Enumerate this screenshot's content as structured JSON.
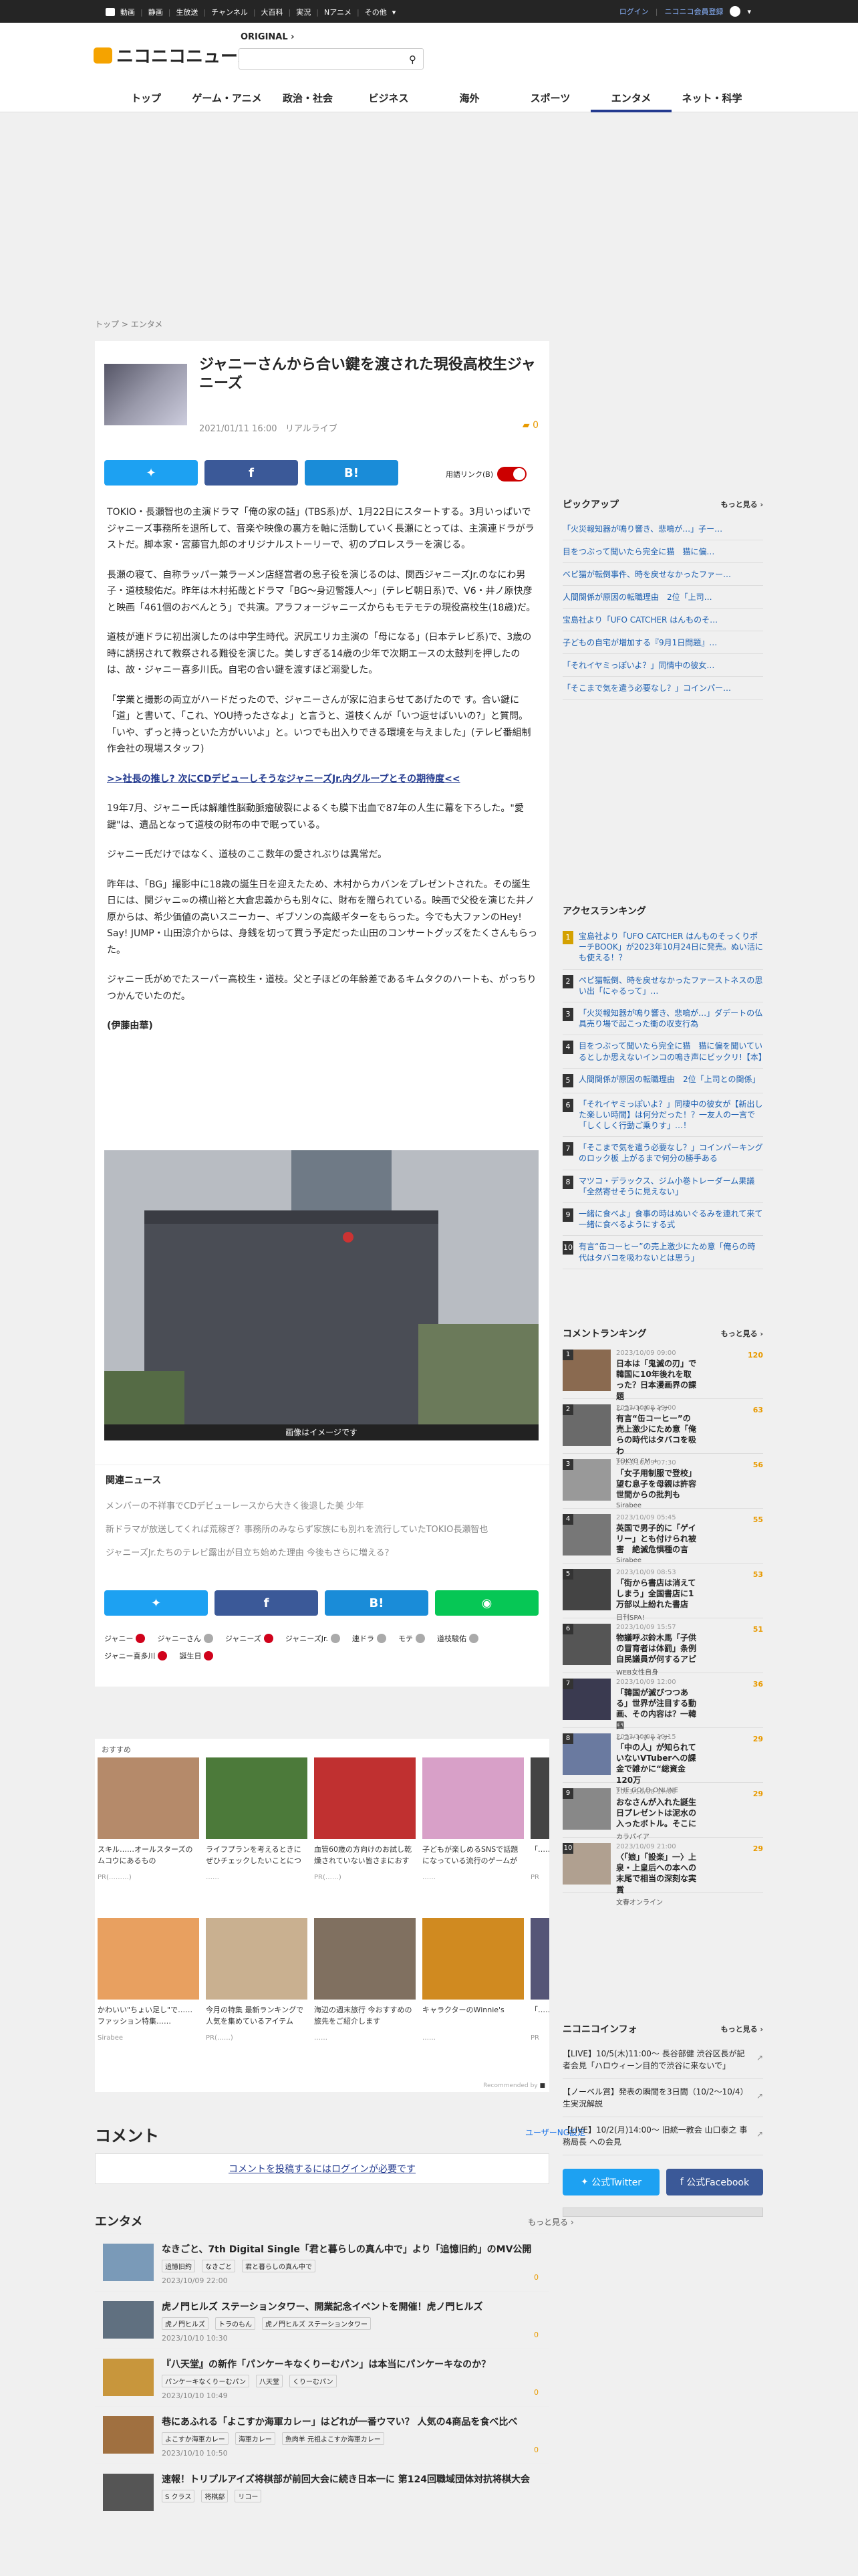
{
  "topbar": {
    "items": [
      "動画",
      "静画",
      "生放送",
      "チャンネル",
      "大百科",
      "実況",
      "Nアニメ",
      "その他"
    ],
    "login": "ログイン",
    "register": "ニコニコ会員登録"
  },
  "header": {
    "logo": "ニコニコニュース",
    "original": "ORIGINAL",
    "search_placeholder": ""
  },
  "nav": [
    "トップ",
    "ゲーム・アニメ",
    "政治・社会",
    "ビジネス",
    "海外",
    "スポーツ",
    "エンタメ",
    "ネット・科学"
  ],
  "breadcrumb": [
    "トップ",
    "エンタメ"
  ],
  "article": {
    "title": "ジャニーさんから合い鍵を渡された現役高校生ジャニーズ",
    "date": "2021/01/11 16:00",
    "source": "リアルライブ",
    "comment_count": "0",
    "glossary_label": "用語リンク(B)",
    "paragraphs": [
      "TOKIO・長瀬智也の主演ドラマ「俺の家の話」(TBS系)が、1月22日にスタートする。3月いっぱいでジャニーズ事務所を退所して、音楽や映像の裏方を軸に活動していく長瀬にとっては、主演連ドラがラストだ。脚本家・宮藤官九郎のオリジナルストーリーで、初のプロレスラーを演じる。",
      "長瀬の寝て、自称ラッパー兼ラーメン店経営者の息子役を演じるのは、関西ジャニーズJr.のなにわ男子・道枝駿佑だ。昨年は木村拓哉とドラマ「BG〜身辺警護人〜」(テレビ朝日系)で、V6・井ノ原快彦と映画「461個のおべんとう」で共演。アラフォージャニーズからもモテモテの現役高校生(18歳)だ。",
      "道枝が連ドラに初出演したのは中学生時代。沢尻エリカ主演の「母になる」(日本テレビ系)で、3歳の時に誘拐されて教祭される難役を演じた。美しすぎる14歳の少年で次期エースの太鼓判を押したのは、故・ジャニー喜多川氏。自宅の合い鍵を渡すほど溺愛した。",
      "「学業と撮影の両立がハードだったので、ジャニーさんが家に泊まらせてあげたので す。合い鍵に「道」と書いて、「これ、YOU持ったさなよ」と言うと、道枝くんが「いつ返せばいいの?」と質問。「いや、ずっと持っといた方がいいよ」と。いつでも出入りできる環境を与えました」(テレビ番組制作会社の現場スタッフ)",
      "19年7月、ジャニー氏は解離性脳動脈瘤破裂によるくも膜下出血で87年の人生に幕を下ろした。\"愛鍵\"は、遺品となって道枝の財布の中で眠っている。",
      "ジャニー氏だけではなく、道枝のここ数年の愛されぶりは異常だ。",
      "昨年は、「BG」撮影中に18歳の誕生日を迎えたため、木村からカバンをプレゼントされた。その誕生日には、関ジャニ∞の横山裕と大倉忠義からも別々に、財布を贈られている。映画で父役を演じた井ノ原からは、希少価値の高いスニーカー、ギブソンの高級ギターをもらった。今でも大ファンのHey! Say! JUMP・山田涼介からは、身銭を切って買う予定だった山田のコンサートグッズをたくさんもらった。",
      "ジャニー氏がめでたスーパー高校生・道枝。父と子ほどの年齢差であるキムタクのハートも、がっちりつかんでいたのだ。",
      "(伊藤由華)"
    ],
    "promo_link": ">>社長の推し? 次にCDデビューしそうなジャニーズJr.内グループとその期待度<<",
    "photo_caption": "画像はイメージです",
    "related_title": "関連ニュース",
    "related": [
      "メンバーの不祥事でCDデビューレースから大きく後退した美 少年",
      "新ドラマが放送してくれば荒稼ぎ？事務所のみならず家族にも別れを流行していたTOKIO長瀬智也",
      "ジャニーズJr.たちのテレビ露出が目立ち始めた理由 今後もさらに増える？"
    ],
    "tags": [
      {
        "label": "ジャニー",
        "type": "red"
      },
      {
        "label": "ジャニーさん",
        "type": "gray"
      },
      {
        "label": "ジャニーズ",
        "type": "red"
      },
      {
        "label": "ジャニーズJr.",
        "type": "gray"
      },
      {
        "label": "連ドラ",
        "type": "gray"
      },
      {
        "label": "モテ",
        "type": "gray"
      },
      {
        "label": "道枝駿佑",
        "type": "gray"
      },
      {
        "label": "ジャニー喜多川",
        "type": "red"
      },
      {
        "label": "誕生日",
        "type": "red"
      }
    ]
  },
  "recommend": {
    "label": "おすすめ",
    "footer": "Recommended by",
    "cards": [
      {
        "title": "スキル……オールスターズのムコウにあるもの",
        "source": "PR(………)",
        "color": "#b58a6a"
      },
      {
        "title": "ライフプランを考えるときにぜひチェックしたいことについて",
        "source": "……",
        "color": "#4c7a3a"
      },
      {
        "title": "血管60歳の方向けのお試し乾燥されていない皆さまにおすすめの",
        "source": "PR(……)",
        "color": "#c03030"
      },
      {
        "title": "子どもが楽しめるSNSで話題になっている流行のゲームが登場",
        "source": "……",
        "color": "#d8a0c8"
      },
      {
        "title": "「……」",
        "source": "PR",
        "color": "#444"
      },
      {
        "title": "かわいい\"ちょい足し\"で……ファッション特集……",
        "source": "Sirabee",
        "color": "#e8a060"
      },
      {
        "title": "今月の特集 最新ランキングで人気を集めているアイテム",
        "source": "PR(……)",
        "color": "#c9b090"
      },
      {
        "title": "海辺の週末旅行 今おすすめの旅先をご紹介します",
        "source": "……",
        "color": "#807060"
      },
      {
        "title": "キャラクターのWinnie's",
        "source": "……",
        "color": "#d08a20"
      },
      {
        "title": "「……」",
        "source": "PR",
        "color": "#557"
      }
    ]
  },
  "comments": {
    "heading": "コメント",
    "ng_setting": "ユーザーNG設定",
    "login_prompt": "コメントを投稿するにはログインが必要です"
  },
  "entame": {
    "heading": "エンタメ",
    "more": "もっと見る",
    "items": [
      {
        "title": "なきごと、7th Digital Single「君と暮らしの真ん中で」より「追憶旧約」のMV公開",
        "tags": [
          "追憶旧約",
          "なきごと",
          "君と暮らしの真ん中で"
        ],
        "date": "2023/10/09 22:00",
        "count": "0",
        "color": "#7a9ab8"
      },
      {
        "title": "虎ノ門ヒルズ ステーションタワー、開業記念イベントを開催！虎ノ門ヒルズ",
        "tags": [
          "虎ノ門ヒルズ",
          "トラのもん",
          "虎ノ門ヒルズ ステーションタワー"
        ],
        "date": "2023/10/10 10:30",
        "count": "0",
        "color": "#607080"
      },
      {
        "title": "『八天堂』の新作「パンケーキなくりーむパン」は本当にパンケーキなのか？",
        "tags": [
          "パンケーキなくりーむパン",
          "八天堂",
          "くりーむパン"
        ],
        "date": "2023/10/10 10:49",
        "count": "0",
        "color": "#c8963c"
      },
      {
        "title": "巷にあふれる「よこすか海軍カレー」はどれが一番ウマい？ 人気の4商品を食べ比べ",
        "tags": [
          "よこすか海軍カレー",
          "海軍カレー",
          "魚肉羊 元祖よこすか海軍カレー"
        ],
        "date": "2023/10/10 10:50",
        "count": "0",
        "color": "#a07040"
      },
      {
        "title": "速報！トリプルアイズ将棋部が前回大会に続き日本一に 第124回職域団体対抗将棋大会",
        "tags": [
          "S クラス",
          "将棋部",
          "リコー"
        ],
        "date": "",
        "count": "",
        "color": "#555"
      }
    ]
  },
  "sidebar": {
    "pickup": {
      "heading": "ピックアップ",
      "more": "もっと見る",
      "items": [
        "「火災報知器が鳴り響き、悲鳴が…」子ー…",
        "目をつぶって聞いたら完全に猫　猫に偏…",
        "ベビ猫が転倒事件、時を戻せなかったファー…",
        "人間関係が原因の転職理由　2位「上司…",
        "宝島社より「UFO CATCHER はんものそ…",
        "子どもの自宅が増加する『9月1日問題』…",
        "「それイヤミっぽいよ？」同情中の彼女…",
        "「そこまで気を遣う必要なし？」コインパー…"
      ]
    },
    "access": {
      "heading": "アクセスランキング",
      "items": [
        "宝島社より「UFO CATCHER はんものそっくりポーチBOOK」が2023年10月24日に発売。ぬい活にも使える！？",
        "ペビ猫転倒、時を戻せなかったファーストネスの思い出「にゃるって」…",
        "「火災報知器が鳴り響き、悲鳴が…」ダデートの仏具売り場で起こった衝の収支行為",
        "目をつぶって聞いたら完全に猫　猫に偏を聞いているとしか思えないインコの鳴き声にビックリ!【本】",
        "人間関係が原因の転職理由　2位「上司との関係」",
        "「それイヤミっぽいよ？」同棲中の彼女が【新出した楽しい時間】は何分だった！？一友人の一言で「しくしく行動ご乗りす」…！",
        "「そこまで気を遣う必要なし？」コインパーキングのロック板 上がるまで何分の勝手ある",
        "マツコ・デラックス、ジム小巻トレーダーム果議　「全然寄せそうに見えない」",
        "一緒に食べよ」食事の時はぬいぐるみを連れて来て一緒に食べるようにする式",
        "有言“缶コーヒー”の売上激少にため意「俺らの時代はタバコを吸わないとは思う」"
      ]
    },
    "comment_ranking": {
      "heading": "コメントランキング",
      "more": "もっと見る",
      "items": [
        {
          "date": "2023/10/09 09:00",
          "title": "日本は「鬼滅の刃」で韓国に10年後れを取った？日本漫画界の課題",
          "source": "レコードチャイナ",
          "count": "120",
          "color": "#8a6a50"
        },
        {
          "date": "2023/10/08 19:00",
          "title": "有言“缶コーヒー”の売上激少にため意「俺らの時代はタバコを吸わ",
          "source": "TOKYO FM +",
          "count": "63",
          "color": "#6a6a6a"
        },
        {
          "date": "2023/10/09 07:30",
          "title": "「女子用制服で登校」望む息子を母親は許容　世間からの批判も",
          "source": "Sirabee",
          "count": "56",
          "color": "#999"
        },
        {
          "date": "2023/10/09 05:45",
          "title": "英国で男子的に「ゲイリー」とも付けられ被害　絶滅危惧種の言",
          "source": "Sirabee",
          "count": "55",
          "color": "#777"
        },
        {
          "date": "2023/10/09 08:53",
          "title": "「街から書店は消えてしまう」全国書店に1万部以上紛れた書店",
          "source": "日刊SPA!",
          "count": "53",
          "color": "#444"
        },
        {
          "date": "2023/10/09 15:57",
          "title": "物議呼ぶ鈴木馬「子供の冒育者は体罰」条例　自民議員が何するアピ",
          "source": "WEB女性自身",
          "count": "51",
          "color": "#555"
        },
        {
          "date": "2023/10/09 12:00",
          "title": "「韓国が滅びつつある」世界が注目する動画、その内容は？一韓国",
          "source": "レコードチャイナ",
          "count": "36",
          "color": "#3a3a50"
        },
        {
          "date": "2023/10/08 10:15",
          "title": "「中の人」が知られていないVTuberへの課金で雑かに“総資金120万",
          "source": "THE GOLD ONLINE",
          "count": "29",
          "color": "#6a7aa0"
        },
        {
          "date": "2023/10/08 17:00",
          "title": "おなさんが入れた誕生日プレゼントは泥水の入ったボトル。そこに",
          "source": "カラパイア",
          "count": "29",
          "color": "#888"
        },
        {
          "date": "2023/10/09 21:00",
          "title": "〈「娘」「設楽」一〉上泉・上皇后への本への末尾で相当の深刻な実賞",
          "source": "文春オンライン",
          "count": "29",
          "color": "#b0a090"
        }
      ]
    },
    "coin": {
      "heading": "ニコニコインフォ",
      "more": "もっと見る",
      "items": [
        "【LIVE】10/5(木)11:00～ 長谷部健 渋谷区長が記者会見「ハロウィーン目的で渋谷に来ないで」",
        "【ノーベル賞】発表の瞬間を3日間（10/2～10/4）生実況解説",
        "【LIVE】10/2(月)14:00～ 旧統一教会 山口泰之 事務局長 への会見"
      ]
    },
    "official": [
      "公式Twitter",
      "公式Facebook"
    ]
  }
}
